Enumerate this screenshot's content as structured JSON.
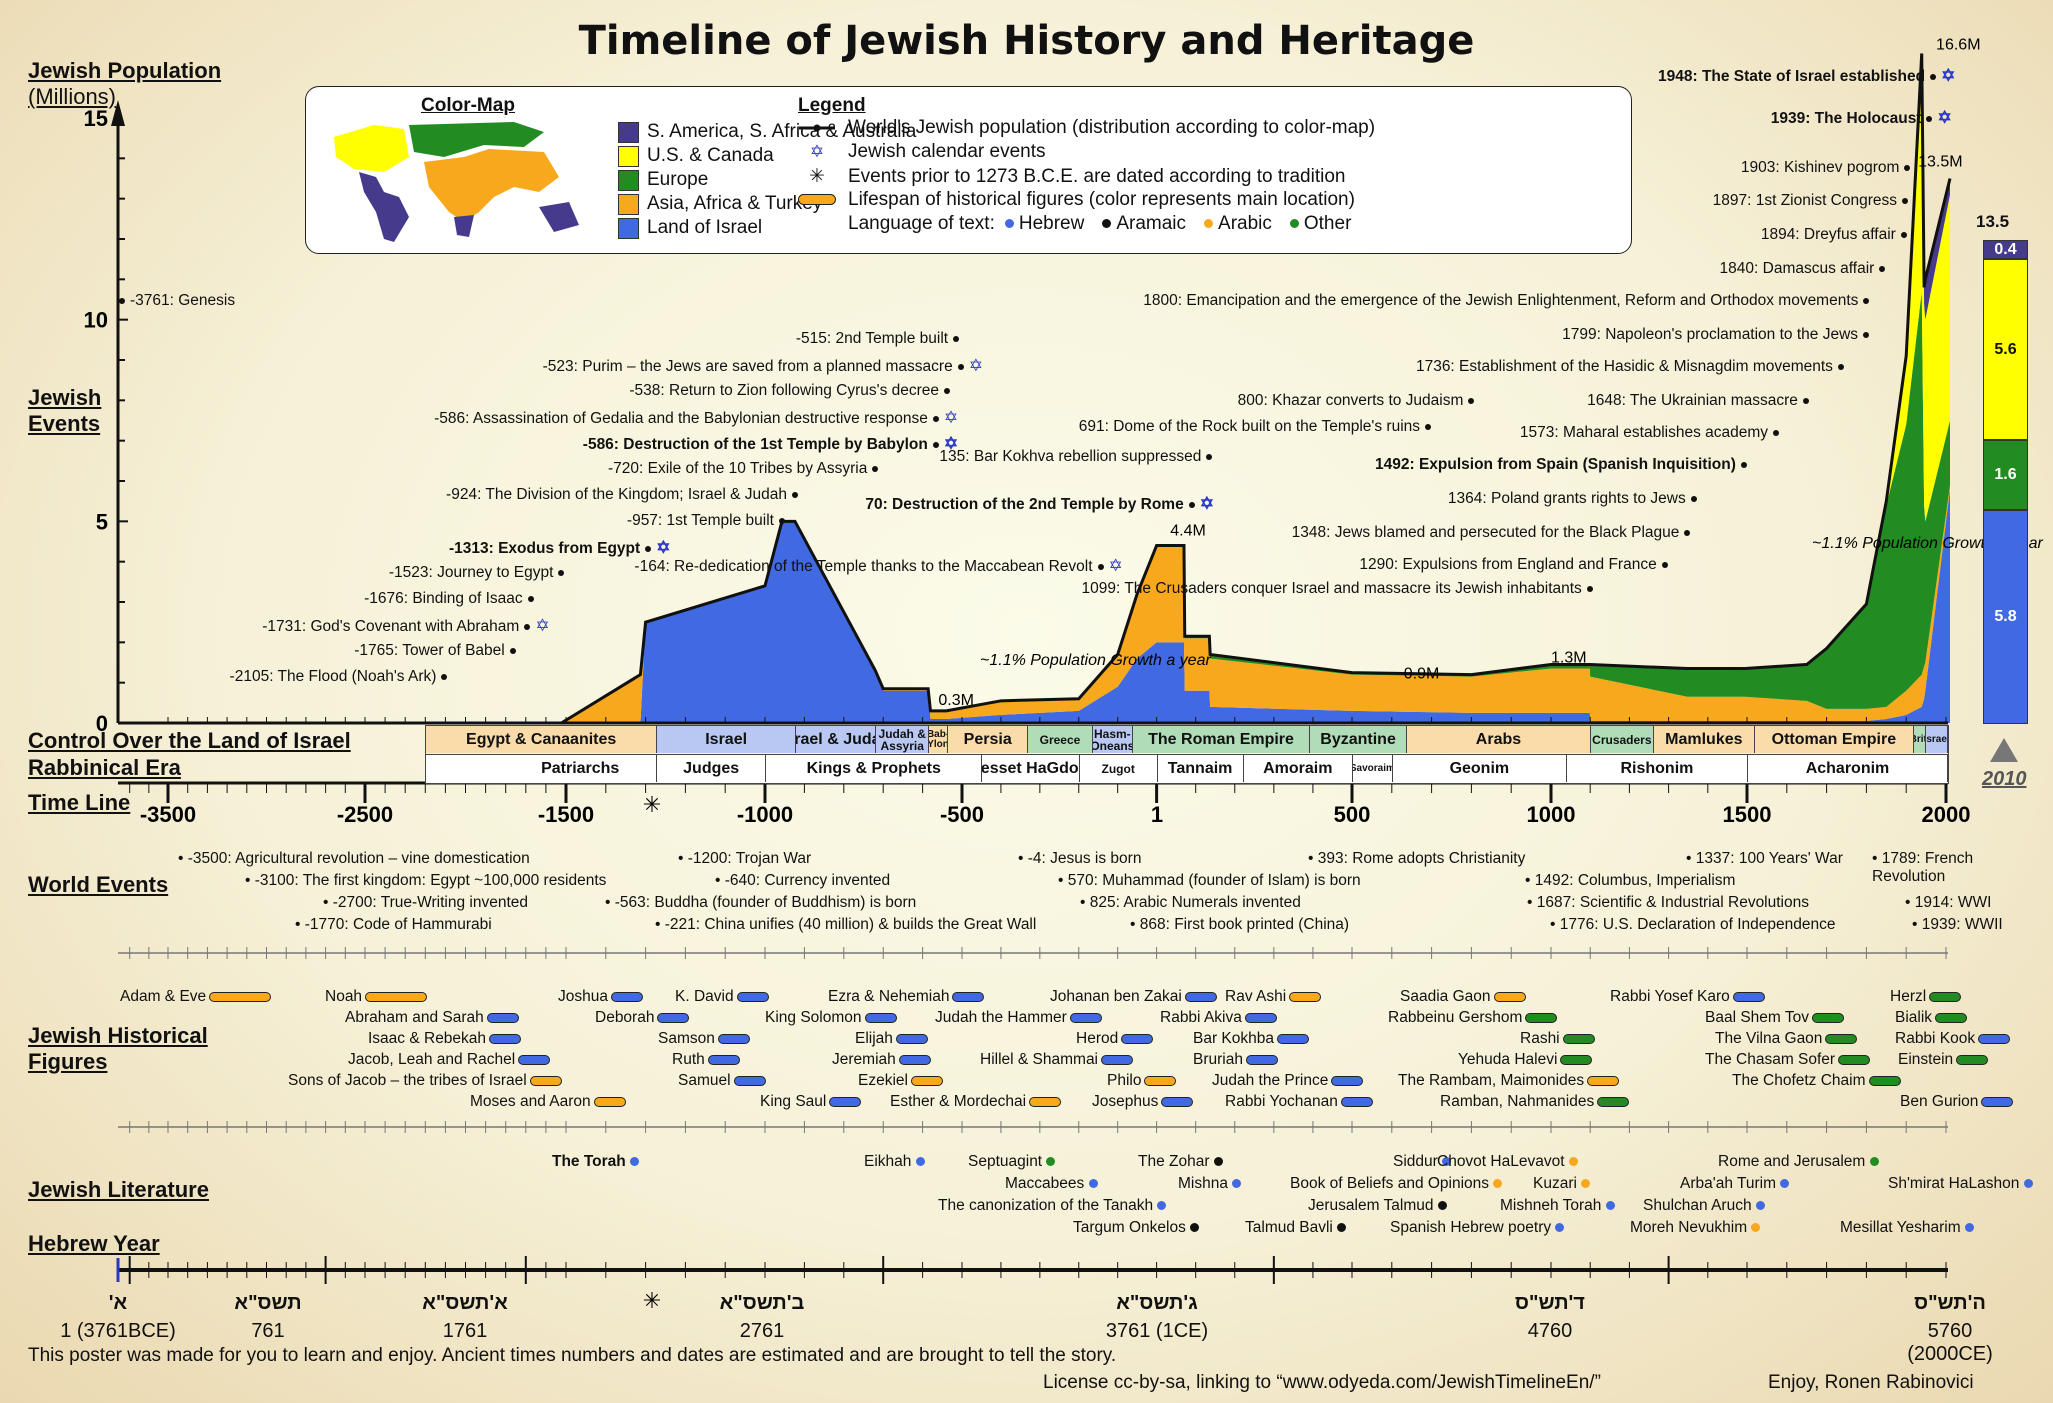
{
  "title": "Timeline of Jewish History and Heritage",
  "sections": {
    "population": "Jewish Population",
    "population_unit": "(Millions)",
    "jewish_events": "Jewish Events",
    "control": "Control Over the Land of Israel",
    "rabbinical": "Rabbinical Era",
    "timeline": "Time Line",
    "world_events": "World Events",
    "figures_1": "Jewish Historical",
    "figures_2": "Figures",
    "literature": "Jewish Literature",
    "hebrew_year": "Hebrew Year"
  },
  "colors": {
    "s_america": "#463a8c",
    "us_canada": "#ffff00",
    "europe": "#228b22",
    "asia_africa": "#f8a81c",
    "israel": "#4169e1",
    "star": "#2a38c8"
  },
  "color_map": {
    "heading": "Color-Map",
    "items": [
      {
        "label": "S. America, S. Africa & Australia",
        "key": "s_america"
      },
      {
        "label": "U.S. & Canada",
        "key": "us_canada"
      },
      {
        "label": "Europe",
        "key": "europe"
      },
      {
        "label": "Asia, Africa & Turkey",
        "key": "asia_africa"
      },
      {
        "label": "Land of Israel",
        "key": "israel"
      }
    ]
  },
  "legend": {
    "heading": "Legend",
    "population_line": "World's Jewish population (distribution according to color-map)",
    "calendar": "Jewish calendar events",
    "tradition": "Events prior to 1273 B.C.E. are dated according to tradition",
    "lifespan": "Lifespan of historical figures (color represents main location)",
    "language_label": "Language of text:",
    "languages": [
      {
        "label": "Hebrew",
        "color": "#4169e1"
      },
      {
        "label": "Aramaic",
        "color": "#111111"
      },
      {
        "label": "Arabic",
        "color": "#f8a81c"
      },
      {
        "label": "Other",
        "color": "#228b22"
      }
    ]
  },
  "chart_data": {
    "type": "area",
    "title": "Jewish Population (Millions)",
    "xlabel": "Time Line",
    "ylabel": "Jewish Population (Millions)",
    "xlim": [
      -3761,
      2010
    ],
    "ylim": [
      0,
      17
    ],
    "yticks": [
      0,
      5,
      10,
      15
    ],
    "xticks": [
      -3500,
      -2500,
      -1500,
      -1000,
      -500,
      1,
      500,
      1000,
      1500,
      2000
    ],
    "x": [
      -1523,
      -1313,
      -1300,
      -1000,
      -957,
      -924,
      -720,
      -700,
      -586,
      -580,
      -540,
      -400,
      -200,
      -100,
      -50,
      0,
      70,
      72,
      135,
      137,
      500,
      800,
      1000,
      1099,
      1100,
      1348,
      1350,
      1492,
      1495,
      1648,
      1650,
      1700,
      1800,
      1850,
      1900,
      1939,
      1945,
      1948,
      2010
    ],
    "series": [
      {
        "name": "Land of Israel",
        "values": [
          0,
          0,
          2.5,
          3.4,
          5.0,
          5.0,
          1.3,
          0.8,
          0.8,
          0.1,
          0.1,
          0.2,
          0.3,
          0.9,
          1.6,
          2.0,
          2.0,
          0.8,
          0.8,
          0.4,
          0.3,
          0.25,
          0.25,
          0.25,
          0.05,
          0.05,
          0.05,
          0.05,
          0.05,
          0.05,
          0.05,
          0.05,
          0.05,
          0.1,
          0.2,
          0.4,
          0.6,
          0.8,
          5.8
        ]
      },
      {
        "name": "Asia, Africa & Turkey",
        "values": [
          0,
          1.2,
          0,
          0,
          0,
          0,
          0,
          0.05,
          0.05,
          0.2,
          0.2,
          0.35,
          0.3,
          0.8,
          1.6,
          2.4,
          2.4,
          1.3,
          1.3,
          1.2,
          0.9,
          0.9,
          1.1,
          1.1,
          1.1,
          0.6,
          0.6,
          0.6,
          0.6,
          0.5,
          0.5,
          0.3,
          0.3,
          0.3,
          0.6,
          0.8,
          0.8,
          0.7,
          0.1
        ]
      },
      {
        "name": "Europe",
        "values": [
          0,
          0,
          0,
          0,
          0,
          0,
          0,
          0,
          0,
          0,
          0,
          0,
          0,
          0,
          0,
          0,
          0,
          0.05,
          0.05,
          0.1,
          0.05,
          0.05,
          0.1,
          0.1,
          0.3,
          0.7,
          0.7,
          0.7,
          0.7,
          0.9,
          0.9,
          1.5,
          2.6,
          5.0,
          6.6,
          9.5,
          4.0,
          3.5,
          1.6
        ]
      },
      {
        "name": "U.S. & Canada",
        "values": [
          0,
          0,
          0,
          0,
          0,
          0,
          0,
          0,
          0,
          0,
          0,
          0,
          0,
          0,
          0,
          0,
          0,
          0,
          0,
          0,
          0,
          0,
          0,
          0,
          0,
          0,
          0,
          0,
          0,
          0,
          0,
          0,
          0,
          0.1,
          1.5,
          5.5,
          5.0,
          5.0,
          5.6
        ]
      },
      {
        "name": "S. America, S. Africa & Australia",
        "values": [
          0,
          0,
          0,
          0,
          0,
          0,
          0,
          0,
          0,
          0,
          0,
          0,
          0,
          0,
          0,
          0,
          0,
          0,
          0,
          0,
          0,
          0,
          0,
          0,
          0,
          0,
          0,
          0,
          0,
          0,
          0,
          0,
          0,
          0,
          0.2,
          0.4,
          0.4,
          1.0,
          0.4
        ]
      }
    ],
    "annotations": [
      "0.3M",
      "4.4M",
      "0.9M",
      "1.3M",
      "13.5M",
      "16.6M"
    ],
    "growth_notes": [
      "~1.1% Population Growth a year",
      "~1.1% Population Growth a year"
    ],
    "breakdown_2010": {
      "total": "13.5",
      "segments": [
        {
          "label": "0.4",
          "key": "s_america"
        },
        {
          "label": "5.6",
          "key": "us_canada"
        },
        {
          "label": "1.6",
          "key": "europe"
        },
        {
          "label": "5.8",
          "key": "israel"
        }
      ],
      "year": "2010"
    }
  },
  "jewish_events": [
    {
      "text": "-3761: Genesis",
      "bold": false
    },
    {
      "text": "-2105: The Flood (Noah's Ark)",
      "bold": false
    },
    {
      "text": "-1765: Tower of Babel",
      "bold": false
    },
    {
      "text": "-1731: God's Covenant with Abraham",
      "bold": false,
      "star": true
    },
    {
      "text": "-1676: Binding of Isaac",
      "bold": false
    },
    {
      "text": "-1523: Journey to Egypt",
      "bold": false
    },
    {
      "text": "-1313: Exodus from Egypt",
      "bold": true,
      "star": true
    },
    {
      "text": "-957: 1st Temple built",
      "bold": false
    },
    {
      "text": "-924: The Division of the Kingdom; Israel & Judah",
      "bold": false
    },
    {
      "text": "-720: Exile of the 10 Tribes by Assyria",
      "bold": false
    },
    {
      "text": "-586: Destruction of the 1st Temple by Babylon",
      "bold": true,
      "star": true
    },
    {
      "text": "-586: Assassination of Gedalia and the Babylonian destructive response",
      "bold": false,
      "star": true
    },
    {
      "text": "-538: Return to Zion following Cyrus's decree",
      "bold": false
    },
    {
      "text": "-523: Purim – the Jews are saved from a planned massacre",
      "bold": false,
      "star": true
    },
    {
      "text": "-515: 2nd Temple built",
      "bold": false
    },
    {
      "text": "-164: Re-dedication of the Temple thanks to the Maccabean Revolt",
      "bold": false,
      "star": true
    },
    {
      "text": "70: Destruction of the 2nd Temple by Rome",
      "bold": true,
      "star": true
    },
    {
      "text": "135: Bar Kokhva rebellion suppressed",
      "bold": false
    },
    {
      "text": "691: Dome of the Rock built on the Temple's ruins",
      "bold": false
    },
    {
      "text": "800: Khazar converts to Judaism",
      "bold": false
    },
    {
      "text": "1099: The Crusaders conquer Israel and massacre its Jewish inhabitants",
      "bold": false
    },
    {
      "text": "1290: Expulsions from England and France",
      "bold": false
    },
    {
      "text": "1348: Jews blamed and persecuted for the Black Plague",
      "bold": false
    },
    {
      "text": "1364: Poland grants rights to Jews",
      "bold": false
    },
    {
      "text": "1492: Expulsion from Spain (Spanish Inquisition)",
      "bold": true
    },
    {
      "text": "1573: Maharal establishes academy",
      "bold": false
    },
    {
      "text": "1648: The Ukrainian massacre",
      "bold": false
    },
    {
      "text": "1736: Establishment of the Hasidic & Misnagdim movements",
      "bold": false
    },
    {
      "text": "1799: Napoleon's proclamation to the Jews",
      "bold": false
    },
    {
      "text": "1800: Emancipation and the emergence of the Jewish Enlightenment, Reform and Orthodox movements",
      "bold": false
    },
    {
      "text": "1840: Damascus affair",
      "bold": false
    },
    {
      "text": "1894: Dreyfus affair",
      "bold": false
    },
    {
      "text": "1897: 1st Zionist Congress",
      "bold": false
    },
    {
      "text": "1903: Kishinev pogrom",
      "bold": false
    },
    {
      "text": "1939: The Holocaust",
      "bold": true,
      "star": true
    },
    {
      "text": "1948: The State of Israel established",
      "bold": true,
      "star": true
    }
  ],
  "control": [
    {
      "label": "Egypt & Canaanites",
      "from": -2300,
      "to": -1273,
      "color": "#f9dcaa"
    },
    {
      "label": "Israel",
      "from": -1273,
      "to": -924,
      "color": "#b8c8f2"
    },
    {
      "label": "Israel & Judah",
      "from": -924,
      "to": -720,
      "color": "#b8c8f2"
    },
    {
      "label": "Judah & Assyria",
      "from": -720,
      "to": -586,
      "color": "#b8c8f2"
    },
    {
      "label": "Bab-Ylon",
      "from": -586,
      "to": -538,
      "color": "#f9dcaa"
    },
    {
      "label": "Persia",
      "from": -538,
      "to": -332,
      "color": "#f9dcaa"
    },
    {
      "label": "Greece",
      "from": -332,
      "to": -167,
      "color": "#b0dcb8"
    },
    {
      "label": "Hasm-Oneans",
      "from": -167,
      "to": -63,
      "color": "#b8c8f2"
    },
    {
      "label": "The Roman Empire",
      "from": -63,
      "to": 390,
      "color": "#b0dcb8"
    },
    {
      "label": "Byzantine",
      "from": 390,
      "to": 636,
      "color": "#b0dcb8"
    },
    {
      "label": "Arabs",
      "from": 636,
      "to": 1099,
      "color": "#f9dcaa"
    },
    {
      "label": "Crusaders",
      "from": 1099,
      "to": 1260,
      "color": "#b0dcb8"
    },
    {
      "label": "Mamlukes",
      "from": 1260,
      "to": 1517,
      "color": "#f9dcaa"
    },
    {
      "label": "Ottoman Empire",
      "from": 1517,
      "to": 1917,
      "color": "#f9dcaa"
    },
    {
      "label": "Brit.",
      "from": 1917,
      "to": 1948,
      "color": "#b0dcb8"
    },
    {
      "label": "Israel",
      "from": 1948,
      "to": 2010,
      "color": "#b8c8f2"
    }
  ],
  "rabbinical": [
    {
      "label": "Patriarchs",
      "from": -1813,
      "to": -1273
    },
    {
      "label": "Judges",
      "from": -1273,
      "to": -1000
    },
    {
      "label": "Kings & Prophets",
      "from": -1000,
      "to": -450
    },
    {
      "label": "Knesset HaGdolah",
      "from": -450,
      "to": -200
    },
    {
      "label": "Zugot",
      "from": -200,
      "to": 0
    },
    {
      "label": "Tannaim",
      "from": 0,
      "to": 220
    },
    {
      "label": "Amoraim",
      "from": 220,
      "to": 500
    },
    {
      "label": "Savoraim",
      "from": 500,
      "to": 600
    },
    {
      "label": "Geonim",
      "from": 600,
      "to": 1038
    },
    {
      "label": "Rishonim",
      "from": 1038,
      "to": 1500
    },
    {
      "label": "Acharonim",
      "from": 1500,
      "to": 2010
    }
  ],
  "timeline_ticks": [
    "-3500",
    "-2500",
    "-1500",
    "-1000",
    "-500",
    "1",
    "500",
    "1000",
    "1500",
    "2000"
  ],
  "world_events": [
    "-3500: Agricultural revolution – vine domestication",
    "-3100: The first kingdom:  Egypt ~100,000 residents",
    "-2700: True-Writing invented",
    "-1770: Code of Hammurabi",
    "-1200: Trojan War",
    "-640: Currency invented",
    "-563: Buddha (founder of Buddhism) is born",
    "-221: China unifies (40 million) & builds the Great Wall",
    "-4: Jesus is born",
    "570: Muhammad (founder of Islam) is born",
    "393: Rome adopts Christianity",
    "825: Arabic Numerals invented",
    "868: First book printed (China)",
    "1337: 100 Years' War",
    "1492: Columbus, Imperialism",
    "1687: Scientific & Industrial Revolutions",
    "1776: U.S. Declaration of Independence",
    "1789: French Revolution",
    "1914: WWI",
    "1939: WWII"
  ],
  "figures": [
    {
      "name": "Adam & Eve",
      "color": "asia_africa"
    },
    {
      "name": "Noah",
      "color": "asia_africa"
    },
    {
      "name": "Abraham and Sarah",
      "color": "israel"
    },
    {
      "name": "Isaac & Rebekah",
      "color": "israel"
    },
    {
      "name": "Jacob, Leah and Rachel",
      "color": "israel"
    },
    {
      "name": "Sons of Jacob – the tribes of Israel",
      "color": "asia_africa"
    },
    {
      "name": "Moses and Aaron",
      "color": "asia_africa"
    },
    {
      "name": "Joshua",
      "color": "israel"
    },
    {
      "name": "Deborah",
      "color": "israel"
    },
    {
      "name": "Samson",
      "color": "israel"
    },
    {
      "name": "Ruth",
      "color": "israel"
    },
    {
      "name": "Samuel",
      "color": "israel"
    },
    {
      "name": "K. David",
      "color": "israel"
    },
    {
      "name": "King Solomon",
      "color": "israel"
    },
    {
      "name": "King Saul",
      "color": "israel"
    },
    {
      "name": "Elijah",
      "color": "israel"
    },
    {
      "name": "Jeremiah",
      "color": "israel"
    },
    {
      "name": "Ezekiel",
      "color": "asia_africa"
    },
    {
      "name": "Esther & Mordechai",
      "color": "asia_africa"
    },
    {
      "name": "Ezra & Nehemiah",
      "color": "israel"
    },
    {
      "name": "Judah the Hammer",
      "color": "israel"
    },
    {
      "name": "Herod",
      "color": "israel"
    },
    {
      "name": "Hillel & Shammai",
      "color": "israel"
    },
    {
      "name": "Philo",
      "color": "asia_africa"
    },
    {
      "name": "Josephus",
      "color": "israel"
    },
    {
      "name": "Johanan ben Zakai",
      "color": "israel"
    },
    {
      "name": "Rabbi Akiva",
      "color": "israel"
    },
    {
      "name": "Bar Kokhba",
      "color": "israel"
    },
    {
      "name": "Bruriah",
      "color": "israel"
    },
    {
      "name": "Judah the Prince",
      "color": "israel"
    },
    {
      "name": "Rabbi Yochanan",
      "color": "israel"
    },
    {
      "name": "Rav Ashi",
      "color": "asia_africa"
    },
    {
      "name": "Saadia Gaon",
      "color": "asia_africa"
    },
    {
      "name": "Rabbeinu Gershom",
      "color": "europe"
    },
    {
      "name": "Rashi",
      "color": "europe"
    },
    {
      "name": "Yehuda Halevi",
      "color": "europe"
    },
    {
      "name": "The Rambam, Maimonides",
      "color": "asia_africa"
    },
    {
      "name": "Ramban, Nahmanides",
      "color": "europe"
    },
    {
      "name": "Rabbi Yosef Karo",
      "color": "israel"
    },
    {
      "name": "Baal Shem Tov",
      "color": "europe"
    },
    {
      "name": "The Vilna Gaon",
      "color": "europe"
    },
    {
      "name": "The Chasam Sofer",
      "color": "europe"
    },
    {
      "name": "The Chofetz Chaim",
      "color": "europe"
    },
    {
      "name": "Herzl",
      "color": "europe"
    },
    {
      "name": "Bialik",
      "color": "europe"
    },
    {
      "name": "Rabbi Kook",
      "color": "israel"
    },
    {
      "name": "Einstein",
      "color": "europe"
    },
    {
      "name": "Ben Gurion",
      "color": "israel"
    }
  ],
  "literature": [
    {
      "title": "The Torah",
      "lang": "Hebrew",
      "bold": true
    },
    {
      "title": "Eikhah",
      "lang": "Hebrew"
    },
    {
      "title": "Septuagint",
      "lang": "Other"
    },
    {
      "title": "Maccabees",
      "lang": "Hebrew"
    },
    {
      "title": "The canonization of the Tanakh",
      "lang": "Hebrew"
    },
    {
      "title": "Targum Onkelos",
      "lang": "Aramaic"
    },
    {
      "title": "The Zohar",
      "lang": "Aramaic"
    },
    {
      "title": "Mishna",
      "lang": "Hebrew"
    },
    {
      "title": "Jerusalem Talmud",
      "lang": "Aramaic"
    },
    {
      "title": "Talmud Bavli",
      "lang": "Aramaic"
    },
    {
      "title": "Siddur",
      "lang": "Hebrew"
    },
    {
      "title": "Book of Beliefs and Opinions",
      "lang": "Arabic"
    },
    {
      "title": "Mishneh Torah",
      "lang": "Hebrew"
    },
    {
      "title": "Spanish Hebrew poetry",
      "lang": "Hebrew"
    },
    {
      "title": "Chovot HaLevavot",
      "lang": "Arabic"
    },
    {
      "title": "Kuzari",
      "lang": "Arabic"
    },
    {
      "title": "Shulchan Aruch",
      "lang": "Hebrew"
    },
    {
      "title": "Moreh Nevukhim",
      "lang": "Arabic"
    },
    {
      "title": "Arba'ah Turim",
      "lang": "Hebrew"
    },
    {
      "title": "Rome and Jerusalem",
      "lang": "Other"
    },
    {
      "title": "Sh'mirat HaLashon",
      "lang": "Hebrew"
    },
    {
      "title": "Mesillat Yesharim",
      "lang": "Hebrew"
    }
  ],
  "hebrew_years": [
    {
      "heb": "א'",
      "num": "1 (3761BCE)"
    },
    {
      "heb": "תשס\"א",
      "num": "761"
    },
    {
      "heb": "א'תשס\"א",
      "num": "1761"
    },
    {
      "heb": "ב'תשס\"א",
      "num": "2761"
    },
    {
      "heb": "ג'תשס\"א",
      "num": "3761 (1CE)"
    },
    {
      "heb": "ד'תש\"ס",
      "num": "4760"
    },
    {
      "heb": "ה'תש\"ס",
      "num": "5760 (2000CE)"
    }
  ],
  "footer": {
    "note": "This poster was made for you to learn and enjoy. Ancient times numbers and dates are estimated and are brought to tell the story.",
    "license": "License cc-by-sa, linking to “www.odyeda.com/JewishTimelineEn/”",
    "credit": "Enjoy, Ronen Rabinovici"
  }
}
